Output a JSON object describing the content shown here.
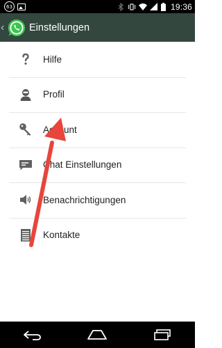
{
  "statusbar": {
    "notification_badge": "63",
    "time": "19:36",
    "icons": [
      "notification-count-icon",
      "image-notification-icon",
      "bluetooth-icon",
      "vibrate-icon",
      "wifi-icon",
      "signal-icon",
      "battery-icon"
    ]
  },
  "actionbar": {
    "title": "Einstellungen",
    "colors": {
      "background": "#34473f",
      "logo": "#3fc350"
    }
  },
  "settings": {
    "items": [
      {
        "label": "Hilfe",
        "icon": "help-icon"
      },
      {
        "label": "Profil",
        "icon": "profile-icon"
      },
      {
        "label": "Account",
        "icon": "key-icon"
      },
      {
        "label": "Chat Einstellungen",
        "icon": "chat-icon"
      },
      {
        "label": "Benachrichtigungen",
        "icon": "speaker-icon"
      },
      {
        "label": "Kontakte",
        "icon": "contacts-icon"
      }
    ]
  },
  "annotation": {
    "type": "arrow",
    "color": "#e8453c",
    "points_to": "Account"
  },
  "navbar": {
    "buttons": [
      "back-nav-icon",
      "home-nav-icon",
      "recent-apps-icon"
    ]
  }
}
